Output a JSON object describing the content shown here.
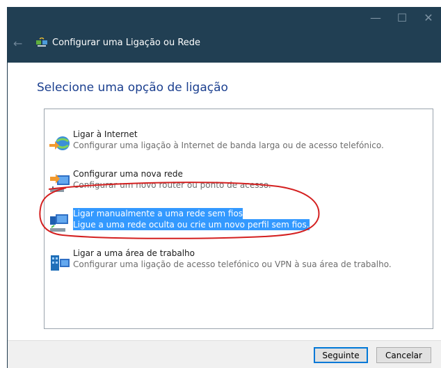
{
  "window": {
    "title": "Configurar uma Ligação ou Rede",
    "controls": {
      "minimize": "—",
      "maximize": "☐",
      "close": "✕"
    }
  },
  "heading": "Selecione uma opção de ligação",
  "options": [
    {
      "title": "Ligar à Internet",
      "description": "Configurar uma ligação à Internet de banda larga ou de acesso telefónico.",
      "icon": "globe-connect-icon",
      "selected": false
    },
    {
      "title": "Configurar uma nova rede",
      "description": "Configurar um novo router ou ponto de acesso.",
      "icon": "router-setup-icon",
      "selected": false
    },
    {
      "title": "Ligar manualmente a uma rede sem fios",
      "description": "Ligue a uma rede oculta ou crie um novo perfil sem fios.",
      "icon": "wireless-network-icon",
      "selected": true
    },
    {
      "title": "Ligar a uma área de trabalho",
      "description": "Configurar uma ligação de acesso telefónico ou VPN à sua área de trabalho.",
      "icon": "workplace-icon",
      "selected": false
    }
  ],
  "footer": {
    "next_label": "Seguinte",
    "cancel_label": "Cancelar"
  },
  "colors": {
    "titlebar": "#213f53",
    "heading": "#1b3f8f",
    "selection": "#3399ff",
    "annotation": "#d42020"
  }
}
